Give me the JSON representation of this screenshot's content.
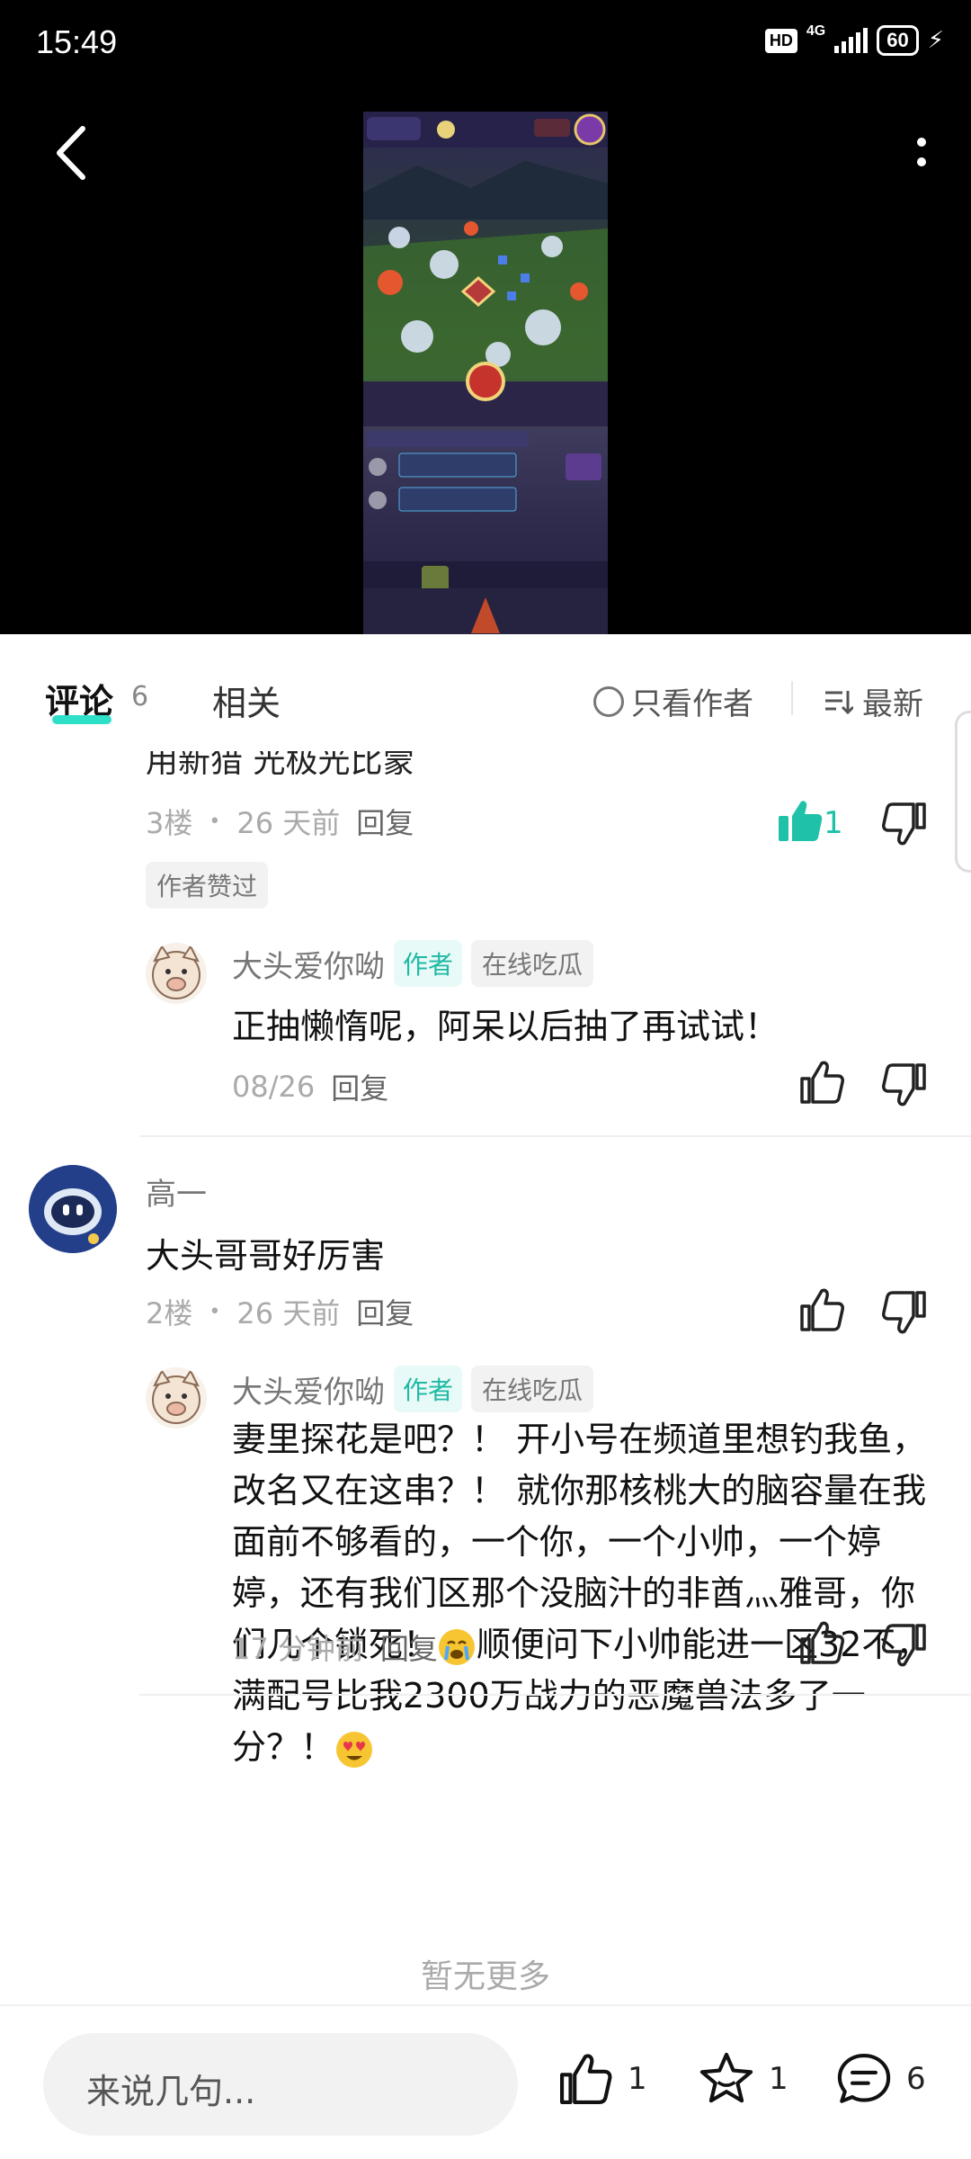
{
  "status_bar": {
    "time": "15:49",
    "hd": "HD",
    "network": "4G",
    "battery": "60"
  },
  "tabs": {
    "comments_label": "评论",
    "comments_count": "6",
    "related_label": "相关",
    "author_only_label": "只看作者",
    "sort_label": "最新"
  },
  "comments": [
    {
      "text_cut": "用新猎 光极光比蒙",
      "floor": "3楼",
      "time": "26 天前",
      "reply_label": "回复",
      "likes": "1",
      "liked": true,
      "badge": "作者赞过",
      "replies": [
        {
          "username": "大头爱你呦",
          "author_tag": "作者",
          "sub_tag": "在线吃瓜",
          "text": "正抽懒惰呢，阿呆以后抽了再试试！",
          "time": "08/26",
          "reply_label": "回复"
        }
      ]
    },
    {
      "username": "高一",
      "text": "大头哥哥好厉害",
      "floor": "2楼",
      "time": "26 天前",
      "reply_label": "回复",
      "replies": [
        {
          "username": "大头爱你呦",
          "author_tag": "作者",
          "sub_tag": "在线吃瓜",
          "text_part1": "妻里探花是吧？！ 开小号在频道里想钓我鱼，改名又在这串？！ 就你那核桃大的脑容量在我面前不够看的，一个你，一个小帅，一个婷婷，还有我们区那个没脑汁的非酋灬雅哥，你们几个锁死！",
          "text_part2": "顺便问下小帅能进一区32不，满配号比我2300万战力的恶魔兽法多了一分？！",
          "time": "17 分钟前",
          "reply_label": "回复"
        }
      ]
    }
  ],
  "no_more": "暂无更多",
  "bottom_bar": {
    "input_placeholder": "来说几句...",
    "like_count": "1",
    "star_count": "1",
    "comment_count": "6"
  },
  "colors": {
    "accent": "#2ee0c8",
    "author_tag": "#1fb9a4",
    "liked": "#1fc2a8"
  }
}
